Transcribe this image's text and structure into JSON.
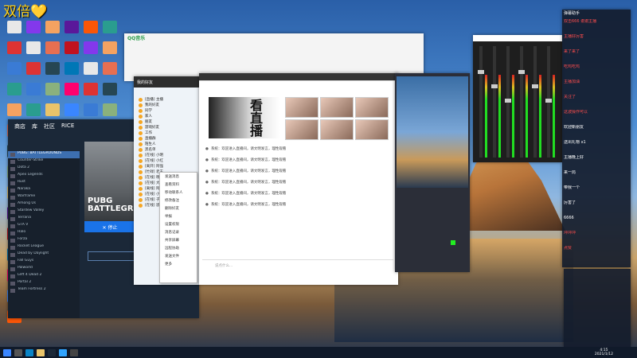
{
  "desktop": {
    "overlay_title": "双倍💛",
    "icons_colors": [
      "#e8e8e8",
      "#d33",
      "#3a7bd5",
      "#2a9d8f",
      "#f4a261",
      "#e76f51",
      "#264653",
      "#8ab17d",
      "#e9c46a",
      "#5a189a",
      "#c1121f",
      "#0077b6",
      "#ff006e",
      "#3a86ff",
      "#fb5607",
      "#8338ec"
    ]
  },
  "browser": {
    "tab": "QQ音乐"
  },
  "launcher": {
    "nav": [
      "商店",
      "库",
      "社区",
      "RICE"
    ],
    "games": [
      "PUBG: BATTLEGROUNDS",
      "Counter-Strike",
      "Dota 2",
      "Apex Legends",
      "Rust",
      "Naraka",
      "Warframe",
      "Among Us",
      "Stardew Valley",
      "Terraria",
      "GTA V",
      "Halo",
      "Forza",
      "Rocket League",
      "Dead by Daylight",
      "Fall Guys",
      "Palworld",
      "Left 4 Dead 2",
      "Portal 2",
      "Team Fortress 2"
    ],
    "selected_index": 0,
    "banner_logo_line1": "PUBG",
    "banner_logo_line2": "BATTLEGROUNDS",
    "play_label": "✕ 停止"
  },
  "qq": {
    "header": "我的好友",
    "buddies": [
      "[直播] 主播",
      "我的好友",
      "同学",
      "家人",
      "朋友",
      "游戏好友",
      "工作",
      "直播群",
      "陌生人",
      "黑名单",
      "[在线] 小明",
      "[在线] 小红",
      "[离开] 阿强",
      "[忙碌] 老王",
      "[在线] 晓晓",
      "[在线] 大宝",
      "[离线] 阿飞",
      "[在线] 小雪",
      "[在线] 子涵",
      "[在线] 思思"
    ],
    "context_menu": [
      "发送消息",
      "查看资料",
      "移动联系人",
      "修改备注",
      "删除好友",
      "举报",
      "设置权限",
      "消息记录",
      "共享屏幕",
      "远程协助",
      "发送文件",
      "更多"
    ]
  },
  "live": {
    "banner_text": "看直播",
    "messages": [
      "系统：欢迎进入直播间，请文明发言，理性观看",
      "系统：欢迎进入直播间，请文明发言，理性观看",
      "系统：欢迎进入直播间，请文明发言，理性观看",
      "系统：欢迎进入直播间，请文明发言，理性观看",
      "系统：欢迎进入直播间，请文明发言，理性观看",
      "系统：欢迎进入直播间，请文明发言，理性观看"
    ],
    "input_placeholder": "说点什么..."
  },
  "chat": {
    "title": "弹幕助手",
    "lines": [
      {
        "text": "双击666 谢谢主播",
        "color": "red"
      },
      {
        "text": "主播好厉害",
        "color": "red"
      },
      {
        "text": "来了来了",
        "color": "red"
      },
      {
        "text": "吃鸡吃鸡",
        "color": "red"
      },
      {
        "text": "主播加油",
        "color": "red"
      },
      {
        "text": "关注了",
        "color": "red"
      },
      {
        "text": "这波操作可以",
        "color": "red"
      },
      {
        "text": "欢迎新朋友",
        "color": "white"
      },
      {
        "text": "送出礼物 x1",
        "color": "white"
      },
      {
        "text": "主播晚上好",
        "color": "white"
      },
      {
        "text": "来一局",
        "color": "white"
      },
      {
        "text": "带我一个",
        "color": "white"
      },
      {
        "text": "厉害了",
        "color": "white"
      },
      {
        "text": "6666",
        "color": "white"
      },
      {
        "text": "冲冲冲",
        "color": "red"
      },
      {
        "text": "点赞",
        "color": "red"
      }
    ]
  },
  "taskbar": {
    "time": "4:15",
    "date": "2021/1/12"
  }
}
